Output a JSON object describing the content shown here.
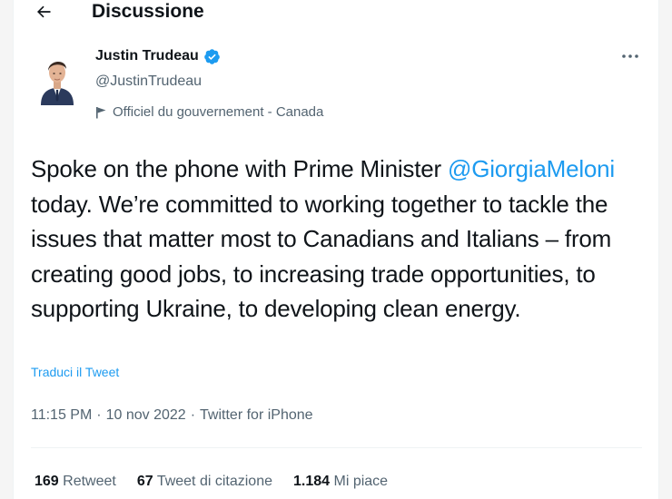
{
  "header": {
    "title": "Discussione",
    "back_icon": "arrow-left-icon"
  },
  "author": {
    "name": "Justin Trudeau",
    "handle": "@JustinTrudeau",
    "verified_icon": "verified-badge-icon",
    "verified_color": "#1d9bf0",
    "gov_label": "Officiel du gouvernement - Canada",
    "gov_icon": "flag-icon"
  },
  "more_icon": "more-horizontal-icon",
  "tweet": {
    "text_before": "Spoke on the phone with Prime Minister ",
    "mention": "@GiorgiaMeloni",
    "text_after": " today. We’re committed to working together to tackle the issues that matter most to Canadians and Italians – from creating good jobs, to increasing trade opportunities, to supporting Ukraine, to developing clean energy.",
    "translate": "Traduci il Tweet",
    "time": "11:15 PM",
    "separator": "·",
    "date": "10 nov 2022",
    "source": "Twitter for iPhone"
  },
  "stats": {
    "retweets_count": "169",
    "retweets_label": "Retweet",
    "quotes_count": "67",
    "quotes_label": "Tweet di citazione",
    "likes_count": "1.184",
    "likes_label": "Mi piace"
  },
  "colors": {
    "accent": "#1d9bf0",
    "secondary_text": "#536471",
    "primary_text": "#0f1419"
  }
}
